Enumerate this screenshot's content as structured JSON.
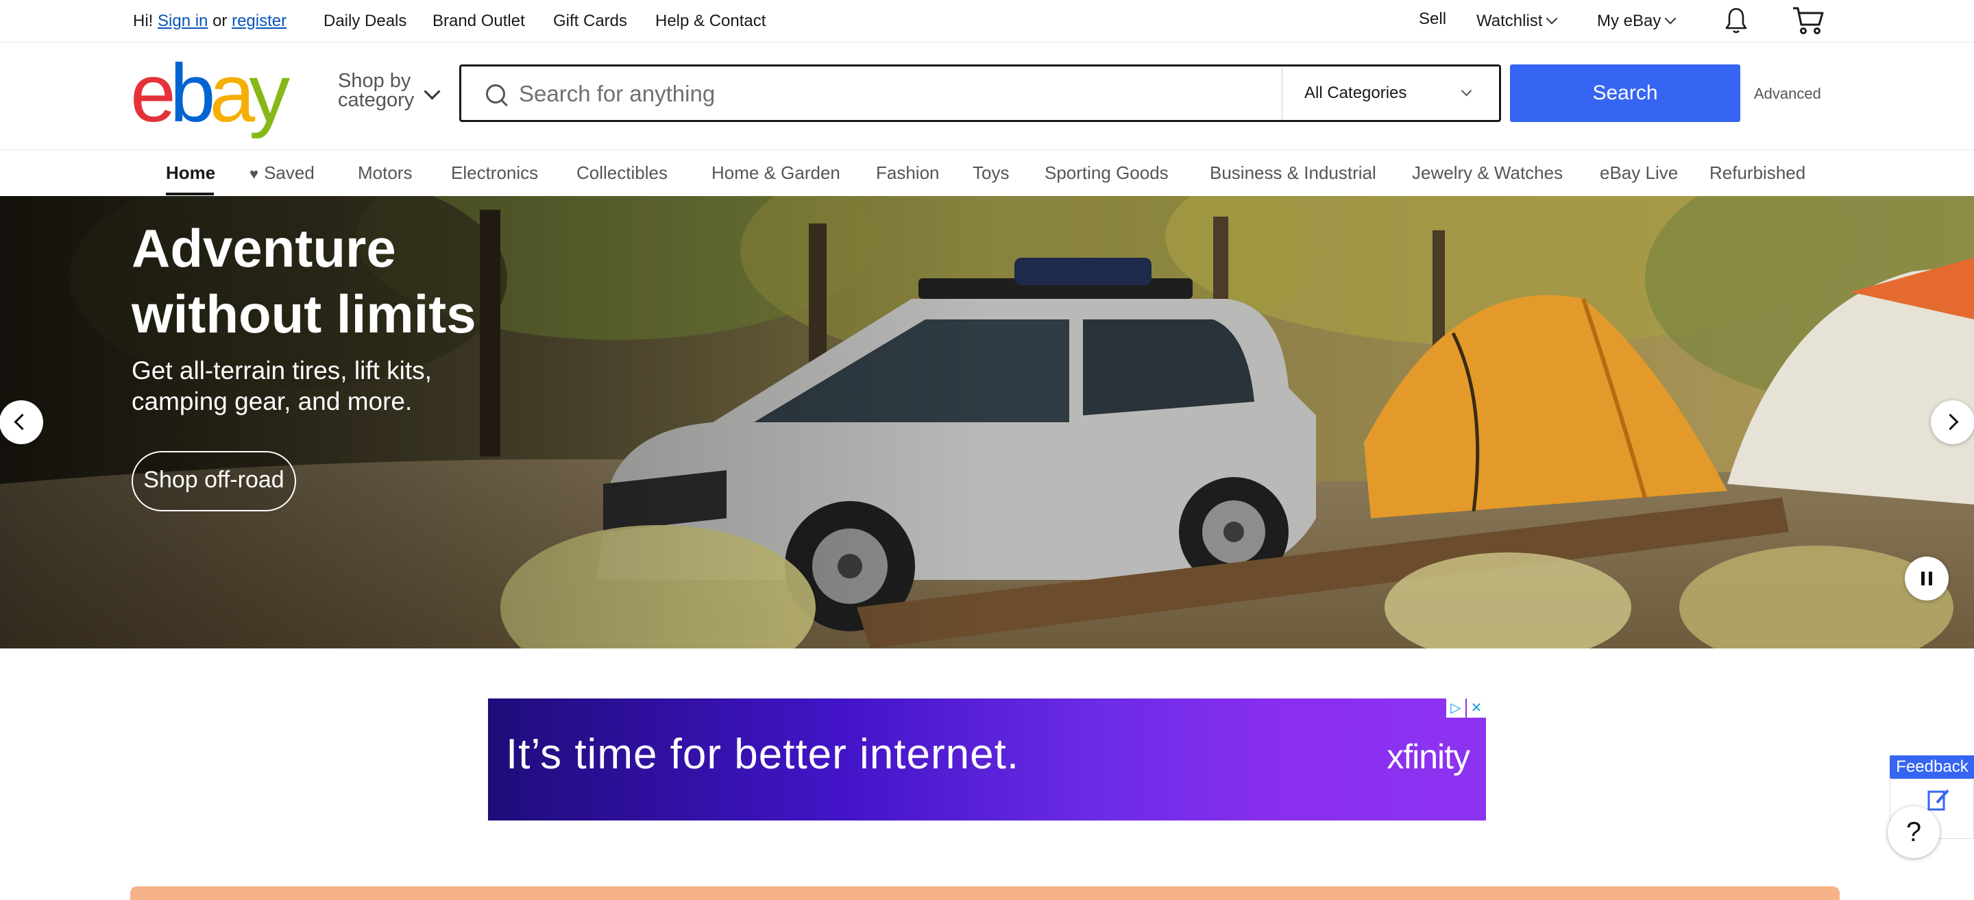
{
  "topbar": {
    "greeting": "Hi!",
    "sign_in": "Sign in",
    "or": "or",
    "register": "register",
    "links": [
      "Daily Deals",
      "Brand Outlet",
      "Gift Cards",
      "Help & Contact"
    ],
    "sell": "Sell",
    "watchlist": "Watchlist",
    "my_ebay": "My eBay",
    "icons": [
      "bell-icon",
      "cart-icon"
    ]
  },
  "header": {
    "logo_letters": [
      "e",
      "b",
      "a",
      "y"
    ],
    "shop_by_line1": "Shop by",
    "shop_by_line2": "category",
    "search_placeholder": "Search for anything",
    "category_select": "All Categories",
    "search_button": "Search",
    "advanced": "Advanced"
  },
  "nav": {
    "items": [
      "Home",
      "Saved",
      "Motors",
      "Electronics",
      "Collectibles",
      "Home & Garden",
      "Fashion",
      "Toys",
      "Sporting Goods",
      "Business & Industrial",
      "Jewelry & Watches",
      "eBay Live",
      "Refurbished"
    ],
    "active": "Home"
  },
  "hero": {
    "title_line1": "Adventure",
    "title_line2": "without limits",
    "subtitle_line1": "Get all-terrain tires, lift kits,",
    "subtitle_line2": "camping gear, and more.",
    "cta": "Shop off-road"
  },
  "ad": {
    "headline": "It’s time for better internet.",
    "brand": "xfinity",
    "colors": {
      "start": "#1f0c7a",
      "end": "#8c33f0"
    }
  },
  "feedback": {
    "label": "Feedback",
    "help": "?"
  },
  "colors": {
    "search_button": "#3665f3",
    "link": "#0654ba",
    "logo_e": "#e53238",
    "logo_b": "#0064d2",
    "logo_a": "#f5af02",
    "logo_y": "#86b817"
  }
}
